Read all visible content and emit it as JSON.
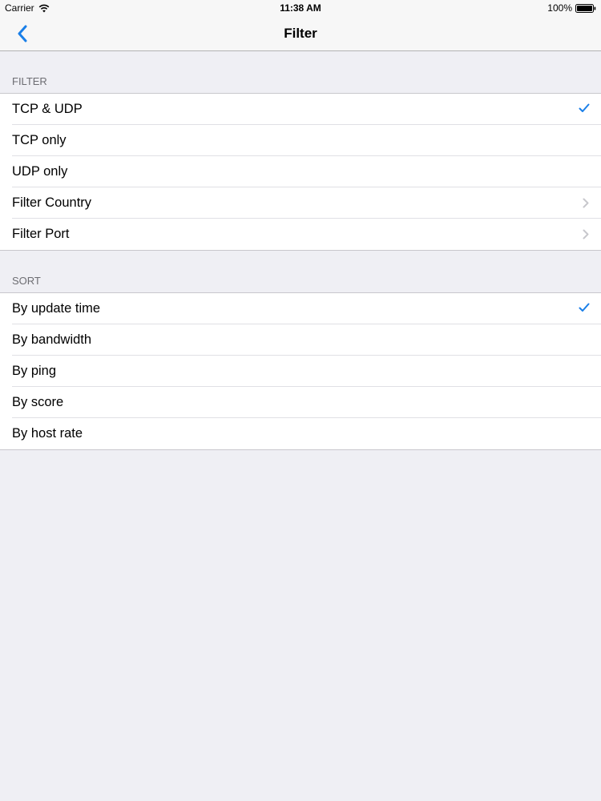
{
  "status_bar": {
    "carrier": "Carrier",
    "time": "11:38 AM",
    "battery": "100%"
  },
  "nav": {
    "title": "Filter"
  },
  "filter_section": {
    "header": "FILTER",
    "items": [
      {
        "label": "TCP & UDP",
        "accessory": "check"
      },
      {
        "label": "TCP only",
        "accessory": "none"
      },
      {
        "label": "UDP only",
        "accessory": "none"
      },
      {
        "label": "Filter Country",
        "accessory": "chevron"
      },
      {
        "label": "Filter Port",
        "accessory": "chevron"
      }
    ]
  },
  "sort_section": {
    "header": "SORT",
    "items": [
      {
        "label": "By update time",
        "accessory": "check"
      },
      {
        "label": "By bandwidth",
        "accessory": "none"
      },
      {
        "label": "By ping",
        "accessory": "none"
      },
      {
        "label": "By score",
        "accessory": "none"
      },
      {
        "label": "By host rate",
        "accessory": "none"
      }
    ]
  },
  "colors": {
    "tint": "#1a7fe8",
    "chevron": "#c7c7cc",
    "background": "#efeff4"
  }
}
